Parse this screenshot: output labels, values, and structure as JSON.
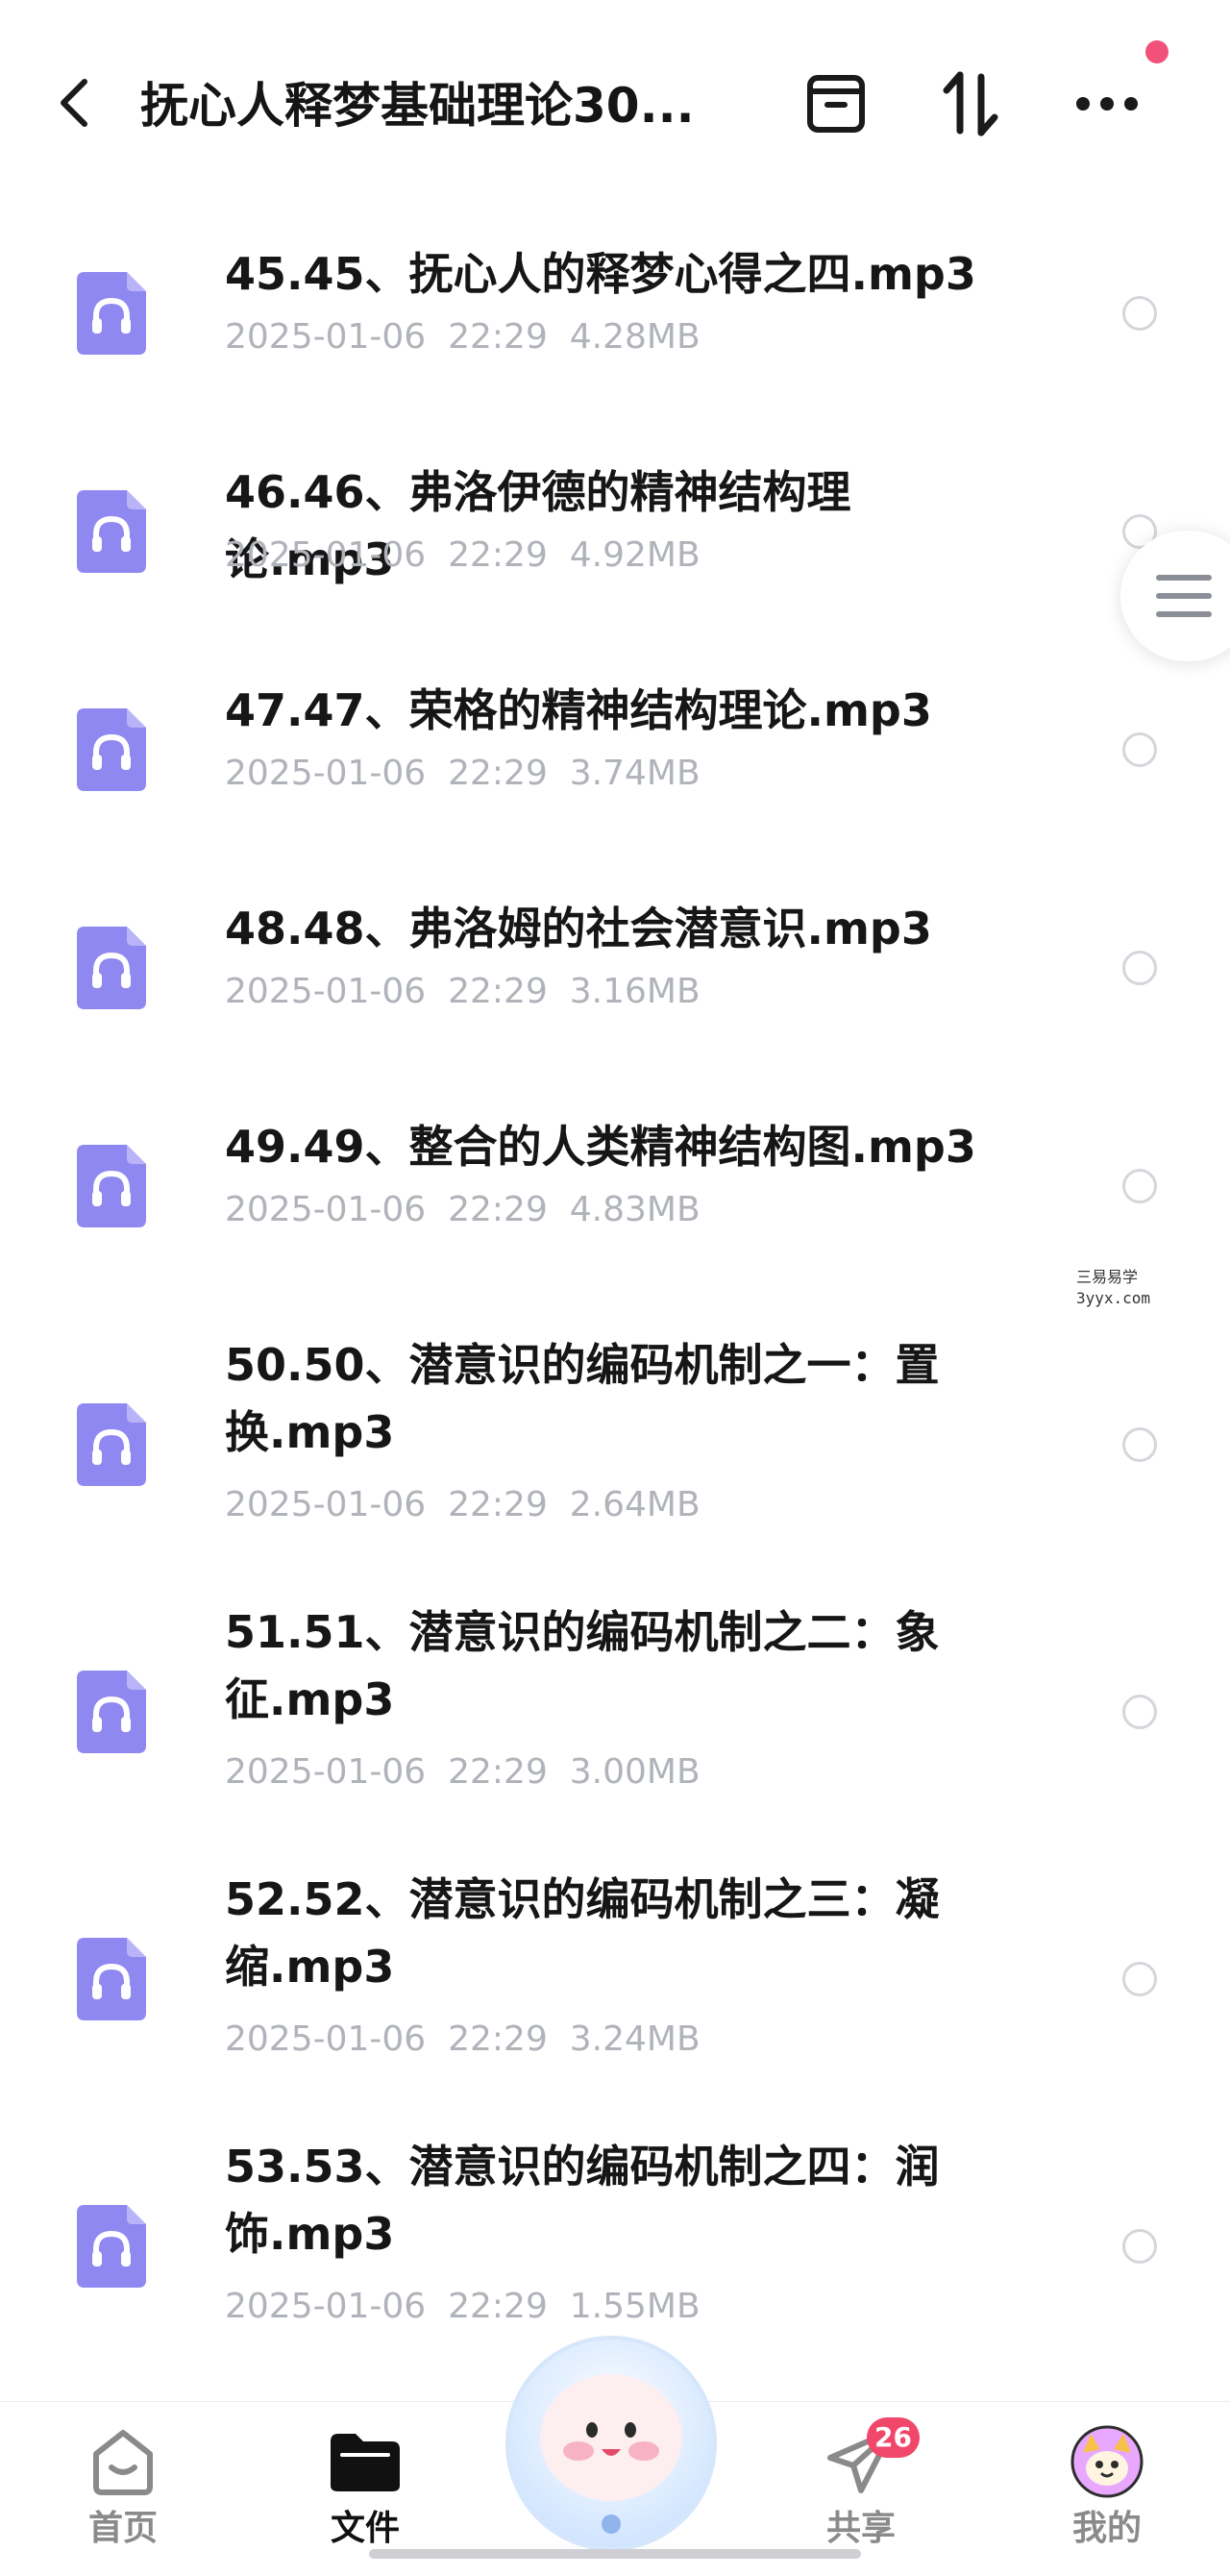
{
  "header": {
    "title": "抚心人释梦基础理论30...",
    "back_icon": "chevron-left-icon",
    "actions": [
      "archive-box-icon",
      "sort-icon",
      "more-icon"
    ]
  },
  "files": [
    {
      "name": "45.45、抚心人的释梦心得之四.mp3",
      "date": "2025-01-06",
      "time": "22:29",
      "size": "4.28MB"
    },
    {
      "name": "46.46、弗洛伊德的精神结构理论.mp3",
      "date": "2025-01-06",
      "time": "22:29",
      "size": "4.92MB"
    },
    {
      "name": "47.47、荣格的精神结构理论.mp3",
      "date": "2025-01-06",
      "time": "22:29",
      "size": "3.74MB"
    },
    {
      "name": "48.48、弗洛姆的社会潜意识.mp3",
      "date": "2025-01-06",
      "time": "22:29",
      "size": "3.16MB"
    },
    {
      "name": "49.49、整合的人类精神结构图.mp3",
      "date": "2025-01-06",
      "time": "22:29",
      "size": "4.83MB"
    },
    {
      "name": "50.50、潜意识的编码机制之一：置换.mp3",
      "date": "2025-01-06",
      "time": "22:29",
      "size": "2.64MB"
    },
    {
      "name": "51.51、潜意识的编码机制之二：象征.mp3",
      "date": "2025-01-06",
      "time": "22:29",
      "size": "3.00MB"
    },
    {
      "name": "52.52、潜意识的编码机制之三：凝缩.mp3",
      "date": "2025-01-06",
      "time": "22:29",
      "size": "3.24MB"
    },
    {
      "name": "53.53、潜意识的编码机制之四：润饰.mp3",
      "date": "2025-01-06",
      "time": "22:29",
      "size": "1.55MB"
    }
  ],
  "watermark": {
    "line1": "三易易学",
    "line2": "3yyx.com"
  },
  "nav": {
    "items": [
      {
        "label": "首页",
        "icon": "home-icon"
      },
      {
        "label": "文件",
        "icon": "folder-icon"
      },
      {
        "label": "共享",
        "icon": "paper-plane-icon",
        "badge": "26"
      },
      {
        "label": "我的",
        "icon": "avatar"
      }
    ],
    "active": "文件"
  },
  "colors": {
    "accent": "#8f88f0",
    "badge": "#f0476a",
    "meta": "#b0b3ba"
  }
}
